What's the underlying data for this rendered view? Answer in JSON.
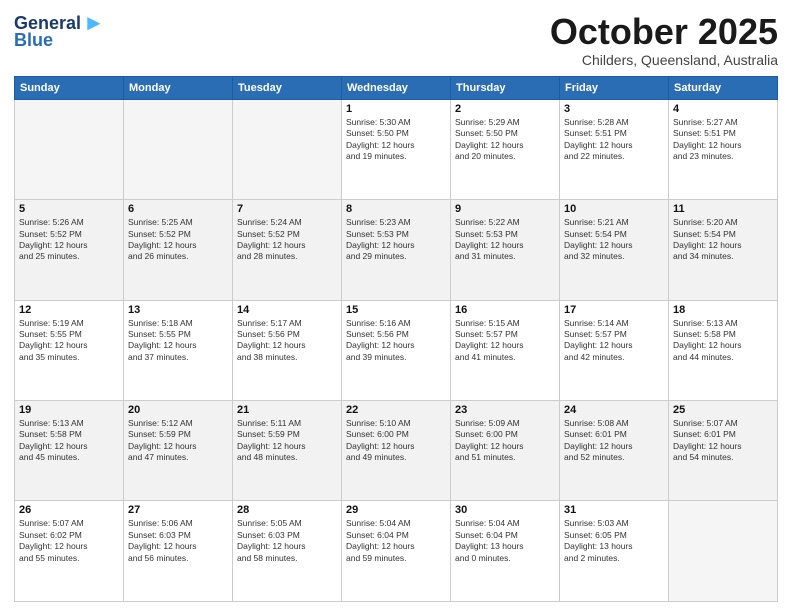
{
  "header": {
    "logo_general": "General",
    "logo_blue": "Blue",
    "month_title": "October 2025",
    "location": "Childers, Queensland, Australia"
  },
  "days_of_week": [
    "Sunday",
    "Monday",
    "Tuesday",
    "Wednesday",
    "Thursday",
    "Friday",
    "Saturday"
  ],
  "weeks": [
    [
      {
        "day": "",
        "info": ""
      },
      {
        "day": "",
        "info": ""
      },
      {
        "day": "",
        "info": ""
      },
      {
        "day": "1",
        "info": "Sunrise: 5:30 AM\nSunset: 5:50 PM\nDaylight: 12 hours\nand 19 minutes."
      },
      {
        "day": "2",
        "info": "Sunrise: 5:29 AM\nSunset: 5:50 PM\nDaylight: 12 hours\nand 20 minutes."
      },
      {
        "day": "3",
        "info": "Sunrise: 5:28 AM\nSunset: 5:51 PM\nDaylight: 12 hours\nand 22 minutes."
      },
      {
        "day": "4",
        "info": "Sunrise: 5:27 AM\nSunset: 5:51 PM\nDaylight: 12 hours\nand 23 minutes."
      }
    ],
    [
      {
        "day": "5",
        "info": "Sunrise: 5:26 AM\nSunset: 5:52 PM\nDaylight: 12 hours\nand 25 minutes."
      },
      {
        "day": "6",
        "info": "Sunrise: 5:25 AM\nSunset: 5:52 PM\nDaylight: 12 hours\nand 26 minutes."
      },
      {
        "day": "7",
        "info": "Sunrise: 5:24 AM\nSunset: 5:52 PM\nDaylight: 12 hours\nand 28 minutes."
      },
      {
        "day": "8",
        "info": "Sunrise: 5:23 AM\nSunset: 5:53 PM\nDaylight: 12 hours\nand 29 minutes."
      },
      {
        "day": "9",
        "info": "Sunrise: 5:22 AM\nSunset: 5:53 PM\nDaylight: 12 hours\nand 31 minutes."
      },
      {
        "day": "10",
        "info": "Sunrise: 5:21 AM\nSunset: 5:54 PM\nDaylight: 12 hours\nand 32 minutes."
      },
      {
        "day": "11",
        "info": "Sunrise: 5:20 AM\nSunset: 5:54 PM\nDaylight: 12 hours\nand 34 minutes."
      }
    ],
    [
      {
        "day": "12",
        "info": "Sunrise: 5:19 AM\nSunset: 5:55 PM\nDaylight: 12 hours\nand 35 minutes."
      },
      {
        "day": "13",
        "info": "Sunrise: 5:18 AM\nSunset: 5:55 PM\nDaylight: 12 hours\nand 37 minutes."
      },
      {
        "day": "14",
        "info": "Sunrise: 5:17 AM\nSunset: 5:56 PM\nDaylight: 12 hours\nand 38 minutes."
      },
      {
        "day": "15",
        "info": "Sunrise: 5:16 AM\nSunset: 5:56 PM\nDaylight: 12 hours\nand 39 minutes."
      },
      {
        "day": "16",
        "info": "Sunrise: 5:15 AM\nSunset: 5:57 PM\nDaylight: 12 hours\nand 41 minutes."
      },
      {
        "day": "17",
        "info": "Sunrise: 5:14 AM\nSunset: 5:57 PM\nDaylight: 12 hours\nand 42 minutes."
      },
      {
        "day": "18",
        "info": "Sunrise: 5:13 AM\nSunset: 5:58 PM\nDaylight: 12 hours\nand 44 minutes."
      }
    ],
    [
      {
        "day": "19",
        "info": "Sunrise: 5:13 AM\nSunset: 5:58 PM\nDaylight: 12 hours\nand 45 minutes."
      },
      {
        "day": "20",
        "info": "Sunrise: 5:12 AM\nSunset: 5:59 PM\nDaylight: 12 hours\nand 47 minutes."
      },
      {
        "day": "21",
        "info": "Sunrise: 5:11 AM\nSunset: 5:59 PM\nDaylight: 12 hours\nand 48 minutes."
      },
      {
        "day": "22",
        "info": "Sunrise: 5:10 AM\nSunset: 6:00 PM\nDaylight: 12 hours\nand 49 minutes."
      },
      {
        "day": "23",
        "info": "Sunrise: 5:09 AM\nSunset: 6:00 PM\nDaylight: 12 hours\nand 51 minutes."
      },
      {
        "day": "24",
        "info": "Sunrise: 5:08 AM\nSunset: 6:01 PM\nDaylight: 12 hours\nand 52 minutes."
      },
      {
        "day": "25",
        "info": "Sunrise: 5:07 AM\nSunset: 6:01 PM\nDaylight: 12 hours\nand 54 minutes."
      }
    ],
    [
      {
        "day": "26",
        "info": "Sunrise: 5:07 AM\nSunset: 6:02 PM\nDaylight: 12 hours\nand 55 minutes."
      },
      {
        "day": "27",
        "info": "Sunrise: 5:06 AM\nSunset: 6:03 PM\nDaylight: 12 hours\nand 56 minutes."
      },
      {
        "day": "28",
        "info": "Sunrise: 5:05 AM\nSunset: 6:03 PM\nDaylight: 12 hours\nand 58 minutes."
      },
      {
        "day": "29",
        "info": "Sunrise: 5:04 AM\nSunset: 6:04 PM\nDaylight: 12 hours\nand 59 minutes."
      },
      {
        "day": "30",
        "info": "Sunrise: 5:04 AM\nSunset: 6:04 PM\nDaylight: 13 hours\nand 0 minutes."
      },
      {
        "day": "31",
        "info": "Sunrise: 5:03 AM\nSunset: 6:05 PM\nDaylight: 13 hours\nand 2 minutes."
      },
      {
        "day": "",
        "info": ""
      }
    ]
  ]
}
